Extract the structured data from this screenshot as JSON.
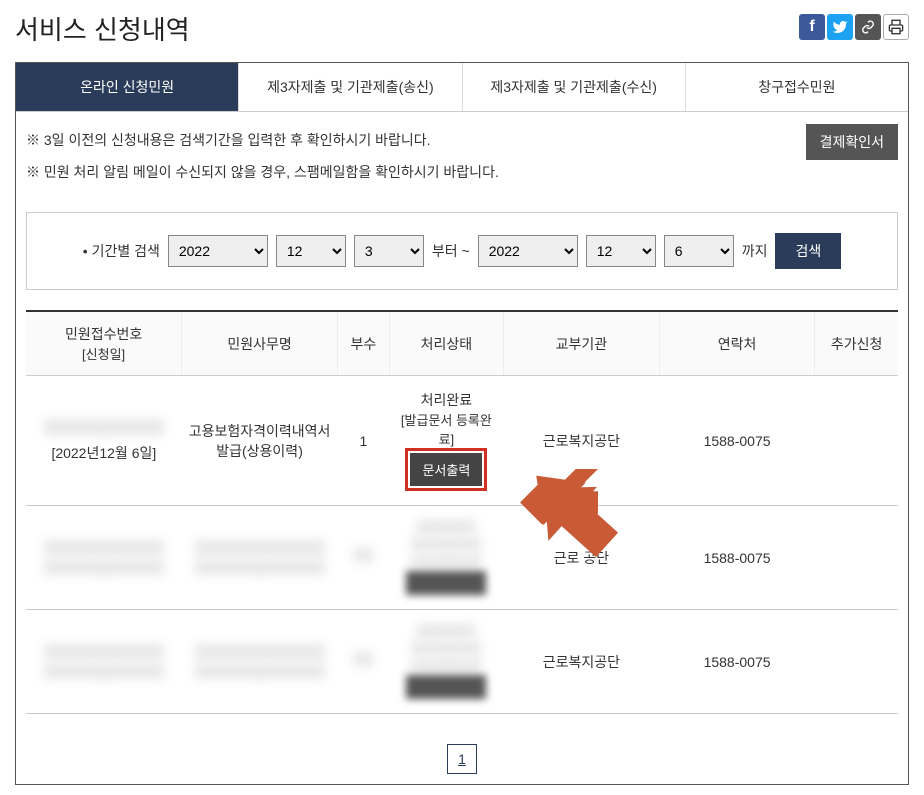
{
  "header": {
    "title": "서비스 신청내역"
  },
  "tabs": [
    "온라인 신청민원",
    "제3자제출 및 기관제출(송신)",
    "제3자제출 및 기관제출(수신)",
    "창구접수민원"
  ],
  "notices": {
    "line1": "※ 3일 이전의 신청내용은 검색기간을 입력한 후 확인하시기 바랍니다.",
    "line2": "※ 민원 처리 알림 메일이 수신되지 않을 경우, 스팸메일함을 확인하시기 바랍니다.",
    "payment_btn": "결제확인서"
  },
  "search": {
    "label": "기간별 검색",
    "from_year": "2022",
    "from_month": "12",
    "from_day": "3",
    "mid": "부터 ~",
    "to_year": "2022",
    "to_month": "12",
    "to_day": "6",
    "suffix": "까지",
    "btn": "검색"
  },
  "table": {
    "headers": {
      "col1a": "민원접수번호",
      "col1b": "[신청일]",
      "col2": "민원사무명",
      "col3": "부수",
      "col4": "처리상태",
      "col5": "교부기관",
      "col6": "연락처",
      "col7": "추가신청"
    },
    "rows": [
      {
        "date": "[2022년12월 6일]",
        "service": "고용보험자격이력내역서 발급(상용이력)",
        "copies": "1",
        "status1": "처리완료",
        "status2": "[발급문서 등록완료]",
        "print_btn": "문서출력",
        "agency": "근로복지공단",
        "phone": "1588-0075"
      },
      {
        "agency": "근로     공단",
        "phone": "1588-0075"
      },
      {
        "agency": "근로복지공단",
        "phone": "1588-0075"
      }
    ]
  },
  "pagination": {
    "current": "1"
  }
}
